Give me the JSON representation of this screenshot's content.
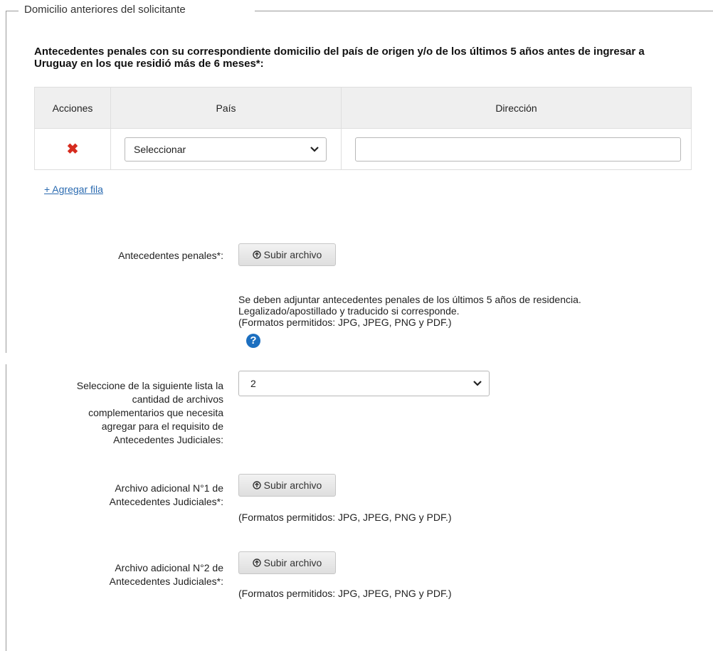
{
  "fieldset": {
    "legend": "Domicilio anteriores del solicitante"
  },
  "section": {
    "heading": "Antecedentes penales con su correspondiente domicilio del país de origen y/o de los últimos 5 años antes de ingresar a Uruguay en los que residió más de 6 meses*:"
  },
  "table": {
    "headers": [
      "Acciones",
      "País",
      "Dirección"
    ],
    "rows": [
      {
        "delete_icon": "✖",
        "country": "Seleccionar",
        "address": ""
      }
    ],
    "add_row_label": "+ Agregar fila"
  },
  "criminal_record": {
    "label": "Antecedentes penales*:",
    "button": "Subir archivo",
    "help_lines": [
      "Se deben adjuntar antecedentes penales de los últimos 5 años de residencia.",
      "Legalizado/apostillado y traducido si corresponde.",
      "(Formatos permitidos: JPG, JPEG, PNG y PDF.)"
    ],
    "help_icon": "?"
  },
  "quantity": {
    "label_lines": [
      "Seleccione de la siguiente lista la",
      "cantidad de archivos",
      "complementarios que necesita",
      "agregar para el requisito de",
      "Antecedentes Judiciales:"
    ],
    "value": "2"
  },
  "additional_files": [
    {
      "label_lines": [
        "Archivo adicional N°1 de",
        "Antecedentes Judiciales*:"
      ],
      "button": "Subir archivo",
      "formats": "(Formatos permitidos: JPG, JPEG, PNG y PDF.)"
    },
    {
      "label_lines": [
        "Archivo adicional N°2 de",
        "Antecedentes Judiciales*:"
      ],
      "button": "Subir archivo",
      "formats": "(Formatos permitidos: JPG, JPEG, PNG y PDF.)"
    }
  ],
  "colors": {
    "delete": "#d62b1e",
    "link": "#2a6ab0",
    "help_icon": "#1c6fc0"
  },
  "icons": {
    "delete": "close-icon",
    "select_arrow": "chevron-down-icon",
    "upload": "upload-circle-icon",
    "help": "question-circle-icon"
  }
}
